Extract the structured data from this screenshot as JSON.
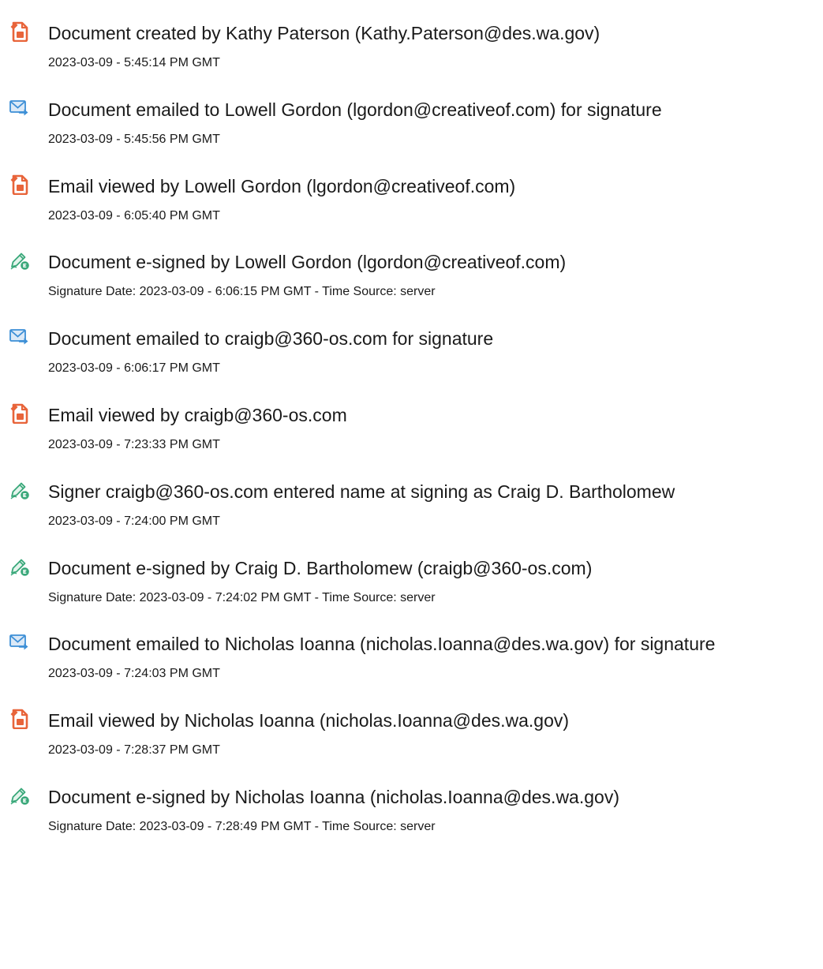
{
  "colors": {
    "doc_icon": "#e8643a",
    "mail_icon": "#3d8fd6",
    "sign_icon": "#3aa87a",
    "text": "#1a1a1a"
  },
  "events": [
    {
      "icon": "document-icon",
      "text": "Document created by Kathy Paterson (Kathy.Paterson@des.wa.gov)",
      "time": "2023-03-09 - 5:45:14 PM GMT"
    },
    {
      "icon": "email-icon",
      "text": "Document emailed to Lowell Gordon (lgordon@creativeof.com) for signature",
      "time": "2023-03-09 - 5:45:56 PM GMT"
    },
    {
      "icon": "document-icon",
      "text": "Email viewed by Lowell Gordon (lgordon@creativeof.com)",
      "time": "2023-03-09 - 6:05:40 PM GMT"
    },
    {
      "icon": "esign-icon",
      "text": "Document e-signed by Lowell Gordon (lgordon@creativeof.com)",
      "time": "Signature Date: 2023-03-09 - 6:06:15 PM GMT - Time Source: server"
    },
    {
      "icon": "email-icon",
      "text": "Document emailed to craigb@360-os.com for signature",
      "time": "2023-03-09 - 6:06:17 PM GMT"
    },
    {
      "icon": "document-icon",
      "text": "Email viewed by craigb@360-os.com",
      "time": "2023-03-09 - 7:23:33 PM GMT"
    },
    {
      "icon": "esign-icon",
      "text": "Signer craigb@360-os.com entered name at signing as Craig D. Bartholomew",
      "time": "2023-03-09 - 7:24:00 PM GMT"
    },
    {
      "icon": "esign-icon",
      "text": "Document e-signed by Craig D. Bartholomew (craigb@360-os.com)",
      "time": "Signature Date: 2023-03-09 - 7:24:02 PM GMT - Time Source: server"
    },
    {
      "icon": "email-icon",
      "text": "Document emailed to Nicholas Ioanna (nicholas.Ioanna@des.wa.gov) for signature",
      "time": "2023-03-09 - 7:24:03 PM GMT"
    },
    {
      "icon": "document-icon",
      "text": "Email viewed by Nicholas Ioanna (nicholas.Ioanna@des.wa.gov)",
      "time": "2023-03-09 - 7:28:37 PM GMT"
    },
    {
      "icon": "esign-icon",
      "text": "Document e-signed by Nicholas Ioanna (nicholas.Ioanna@des.wa.gov)",
      "time": "Signature Date: 2023-03-09 - 7:28:49 PM GMT - Time Source: server"
    }
  ]
}
